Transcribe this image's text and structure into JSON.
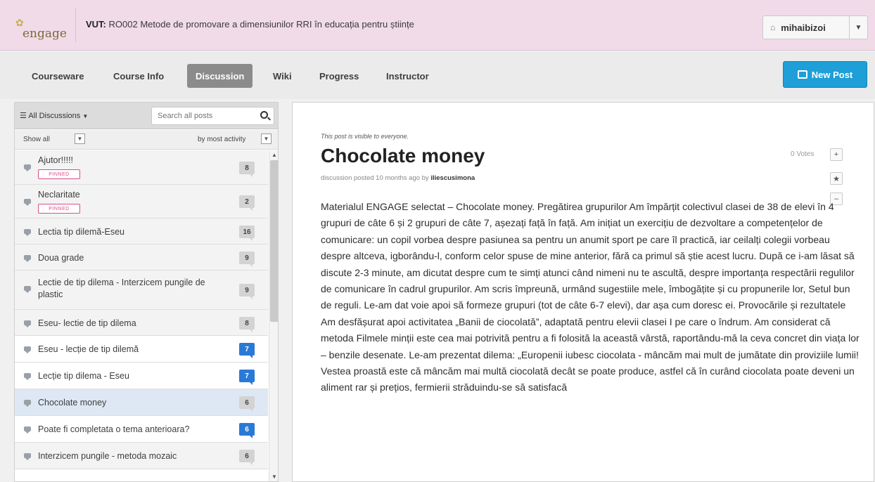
{
  "header": {
    "logo_text": "engage",
    "course_code": "VUT:",
    "course_name": "RO002 Metode de promovare a dimensiunilor RRI în educația pentru științe",
    "username": "mihaibizoi",
    "user_icon": "home-icon",
    "caret_icon": "caret-down-icon"
  },
  "nav": {
    "tabs": [
      {
        "label": "Courseware"
      },
      {
        "label": "Course Info"
      },
      {
        "label": "Discussion"
      },
      {
        "label": "Wiki"
      },
      {
        "label": "Progress"
      },
      {
        "label": "Instructor"
      }
    ],
    "active_tab": "Discussion",
    "new_post_label": "New Post"
  },
  "sidebar": {
    "filter_label": "All Discussions",
    "search_placeholder": "Search all posts",
    "show_label": "Show all",
    "sort_label": "by most activity",
    "pinned_label": "PINNED",
    "threads": [
      {
        "title": "Ajutor!!!!!",
        "count": "8",
        "pinned": true,
        "unread": false
      },
      {
        "title": "Neclaritate",
        "count": "2",
        "pinned": true,
        "unread": false
      },
      {
        "title": "Lectia tip dilemă-Eseu",
        "count": "16",
        "pinned": false,
        "unread": false
      },
      {
        "title": "Doua grade",
        "count": "9",
        "pinned": false,
        "unread": false
      },
      {
        "title": "Lectie de tip dilema - Interzicem pungile de plastic",
        "count": "9",
        "pinned": false,
        "unread": false
      },
      {
        "title": "Eseu- lectie de tip dilema",
        "count": "8",
        "pinned": false,
        "unread": false
      },
      {
        "title": "Eseu - lecție de tip dilemă",
        "count": "7",
        "pinned": false,
        "unread": true
      },
      {
        "title": "Lecție tip dilema - Eseu",
        "count": "7",
        "pinned": false,
        "unread": true
      },
      {
        "title": "Chocolate money",
        "count": "6",
        "pinned": false,
        "unread": false,
        "selected": true
      },
      {
        "title": "Poate fi completata o tema anterioara?",
        "count": "6",
        "pinned": false,
        "unread": true
      },
      {
        "title": "Interzicem pungile - metoda mozaic",
        "count": "6",
        "pinned": false,
        "unread": false
      }
    ]
  },
  "post": {
    "visibility": "This post is visible to everyone.",
    "title": "Chocolate money",
    "meta_prefix": "discussion posted 10 months ago by",
    "author": "iliescusimona",
    "votes": "0 Votes",
    "body": "Materialul ENGAGE selectat – Chocolate money. Pregătirea grupurilor Am împărțit colectivul clasei de 38 de elevi în 4 grupuri de câte 6 și 2 grupuri de câte 7, așezați față în față. Am inițiat un exercițiu de dezvoltare a competențelor de comunicare: un copil vorbea despre pasiunea sa pentru un anumit sport pe care îl practică, iar ceilalți colegii vorbeau despre altceva, igborându-l, conform celor spuse de mine anterior, fără ca primul să știe acest lucru. După ce i-am lăsat să discute 2-3 minute, am dicutat despre cum te simți atunci când nimeni nu te ascultă, despre importanța respectării regulilor de comunicare în cadrul grupurilor. Am scris împreună, urmând sugestiile mele, îmbogățite și cu propunerile lor, Setul bun de reguli. Le-am dat voie apoi să formeze grupuri (tot de câte 6-7 elevi), dar așa cum doresc ei. Provocările și rezultatele Am desfășurat apoi activitatea „Banii de ciocolată”, adaptată pentru elevii clasei I pe care o îndrum. Am considerat că metoda Filmele minții este cea mai potrivită pentru a fi folosită la această vârstă, raportându-mă la ceva concret din viața lor – benzile desenate. Le-am prezentat dilema: „Europenii iubesc ciocolata - mâncăm mai mult de jumătate din proviziile lumii! Vestea proastă este că mâncăm mai multă ciocolată decât se poate produce, astfel că în curând ciocolata poate deveni un aliment rar și prețios, fermierii străduindu-se să satisfacă"
  },
  "colors": {
    "header_bg": "#f1dbe9",
    "accent_blue": "#1e9fd8",
    "unread_badge": "#2b79d6",
    "pinned_pink": "#d8508a",
    "active_tab": "#8b8b8b"
  }
}
